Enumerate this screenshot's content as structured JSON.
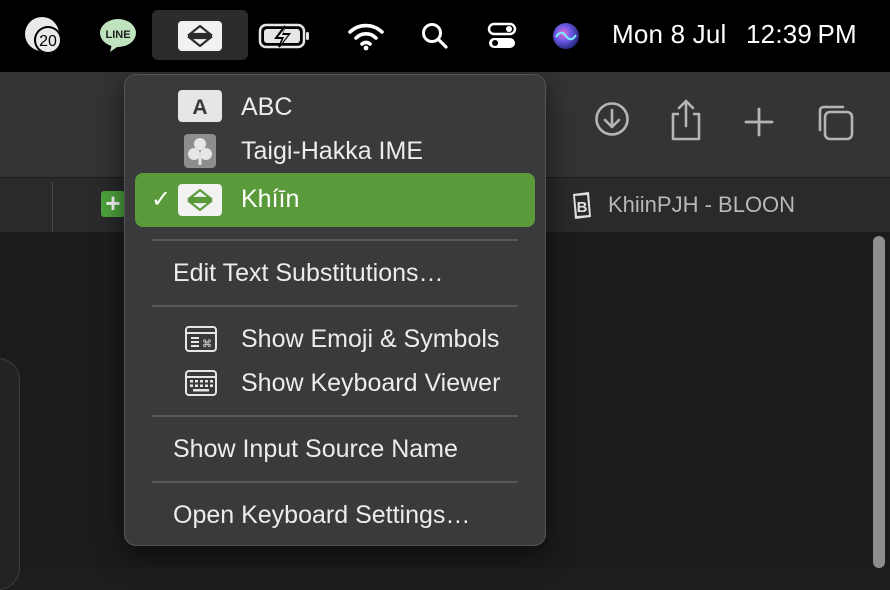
{
  "menubar": {
    "notification_count": "20",
    "line_app_label": "LINE",
    "date": "Mon 8 Jul",
    "time": "12:39 PM",
    "icons": [
      "notification-badge-icon",
      "line-app-icon",
      "input-source-icon",
      "battery-charging-icon",
      "wifi-icon",
      "spotlight-search-icon",
      "control-center-icon",
      "siri-icon"
    ]
  },
  "browser": {
    "tab_title": "KhiinPJH - BLOON",
    "toolbar_icons": [
      "download-icon",
      "share-icon",
      "new-tab-icon",
      "tab-overview-icon"
    ]
  },
  "input_menu": {
    "sources": [
      {
        "label": "ABC",
        "icon_letter": "A",
        "selected": false
      },
      {
        "label": "Taigi-Hakka IME",
        "selected": false
      },
      {
        "label": "Khiin",
        "display": "Khíīn",
        "selected": true
      }
    ],
    "edit_substitutions": "Edit Text Substitutions…",
    "show_emoji": "Show Emoji & Symbols",
    "show_keyboard_viewer": "Show Keyboard Viewer",
    "show_input_source_name": "Show Input Source Name",
    "open_keyboard_settings": "Open Keyboard Settings…",
    "check_mark": "✓",
    "accent_color": "#5a9a3a"
  }
}
